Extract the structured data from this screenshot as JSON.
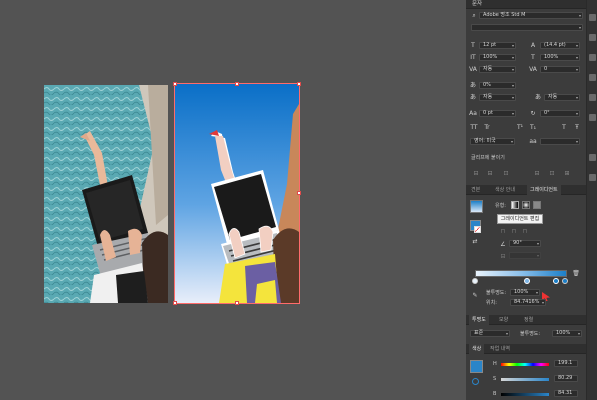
{
  "character": {
    "panel_title": "문자",
    "font_family": "Adobe 명조 Std M",
    "font_style": "",
    "font_size": "12 pt",
    "leading": "(14.4 pt)",
    "vertical_scale": "100%",
    "horizontal_scale": "100%",
    "kerning": "자동",
    "tracking": "0",
    "tsume": "0%",
    "aki_left": "자동",
    "aki_right": "자동",
    "baseline_shift": "0 pt",
    "rotation": "0°",
    "language": "영어: 미국",
    "more_label": "글리프에 붙이기"
  },
  "tabs": [
    {
      "label": "견본"
    },
    {
      "label": "색상 안내"
    },
    {
      "label": "그레이디언트"
    }
  ],
  "gradient": {
    "type_label": "유형:",
    "angle": "90°",
    "opacity_label": "불투명도:",
    "opacity_value": "100%",
    "location_label": "위치:",
    "location_value": "84.7416%",
    "tooltip": "그레이디언트 편집"
  },
  "transparency": {
    "tabs": [
      {
        "label": "투명도"
      },
      {
        "label": "모양"
      },
      {
        "label": "정렬"
      }
    ],
    "blend_mode": "표준",
    "opacity_label": "불투명도:",
    "opacity_value": "100%"
  },
  "color": {
    "tabs": [
      {
        "label": "색상"
      },
      {
        "label": "작업 내역"
      }
    ],
    "h_label": "H",
    "s_label": "S",
    "b_label": "B",
    "h_value": "199.1",
    "s_value": "80.29",
    "b_value": "84.31"
  },
  "colors": {
    "canvas_bg": "#535353",
    "panel_bg": "#3c3c3c",
    "selection": "#ff6b6b",
    "sky_top": "#0a6fc7",
    "sky_bottom": "#e8eefa",
    "gradient_start": "#e8f2fb",
    "gradient_end": "#1c7fc8"
  }
}
